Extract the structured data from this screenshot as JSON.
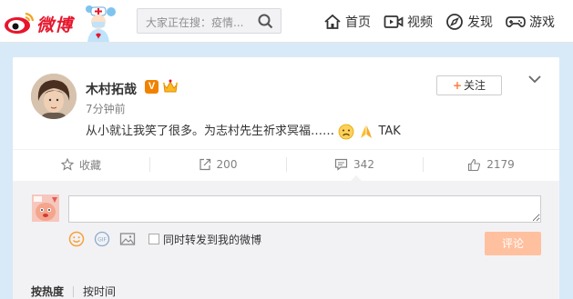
{
  "header": {
    "logo_text": "微博",
    "search": {
      "placeholder": "大家正在搜：疫情..."
    },
    "nav": [
      {
        "label": "首页",
        "icon": "home-icon"
      },
      {
        "label": "视频",
        "icon": "video-icon"
      },
      {
        "label": "发现",
        "icon": "compass-icon"
      },
      {
        "label": "游戏",
        "icon": "gamepad-icon"
      }
    ]
  },
  "post": {
    "author": "木村拓哉",
    "verified_badge": "V",
    "time": "7分钟前",
    "follow_label": "关注",
    "content_text": "从小就让我笑了很多。为志村先生祈求冥福……",
    "content_tail": "TAK",
    "emojis": [
      "sad-face-emoji",
      "pray-hands-emoji"
    ]
  },
  "actions": {
    "favorite_label": "收藏",
    "repost_count": "200",
    "comment_count": "342",
    "like_count": "2179"
  },
  "comment_panel": {
    "input_value": "",
    "repost_checkbox_label": "同时转发到我的微博",
    "submit_label": "评论",
    "sort_options": [
      "按热度",
      "按时间"
    ]
  },
  "colors": {
    "brand_red": "#e6162d",
    "orange_accent": "#fa7d3c",
    "submit_disabled": "#ffc09f",
    "page_bg": "#d8eaf8"
  }
}
